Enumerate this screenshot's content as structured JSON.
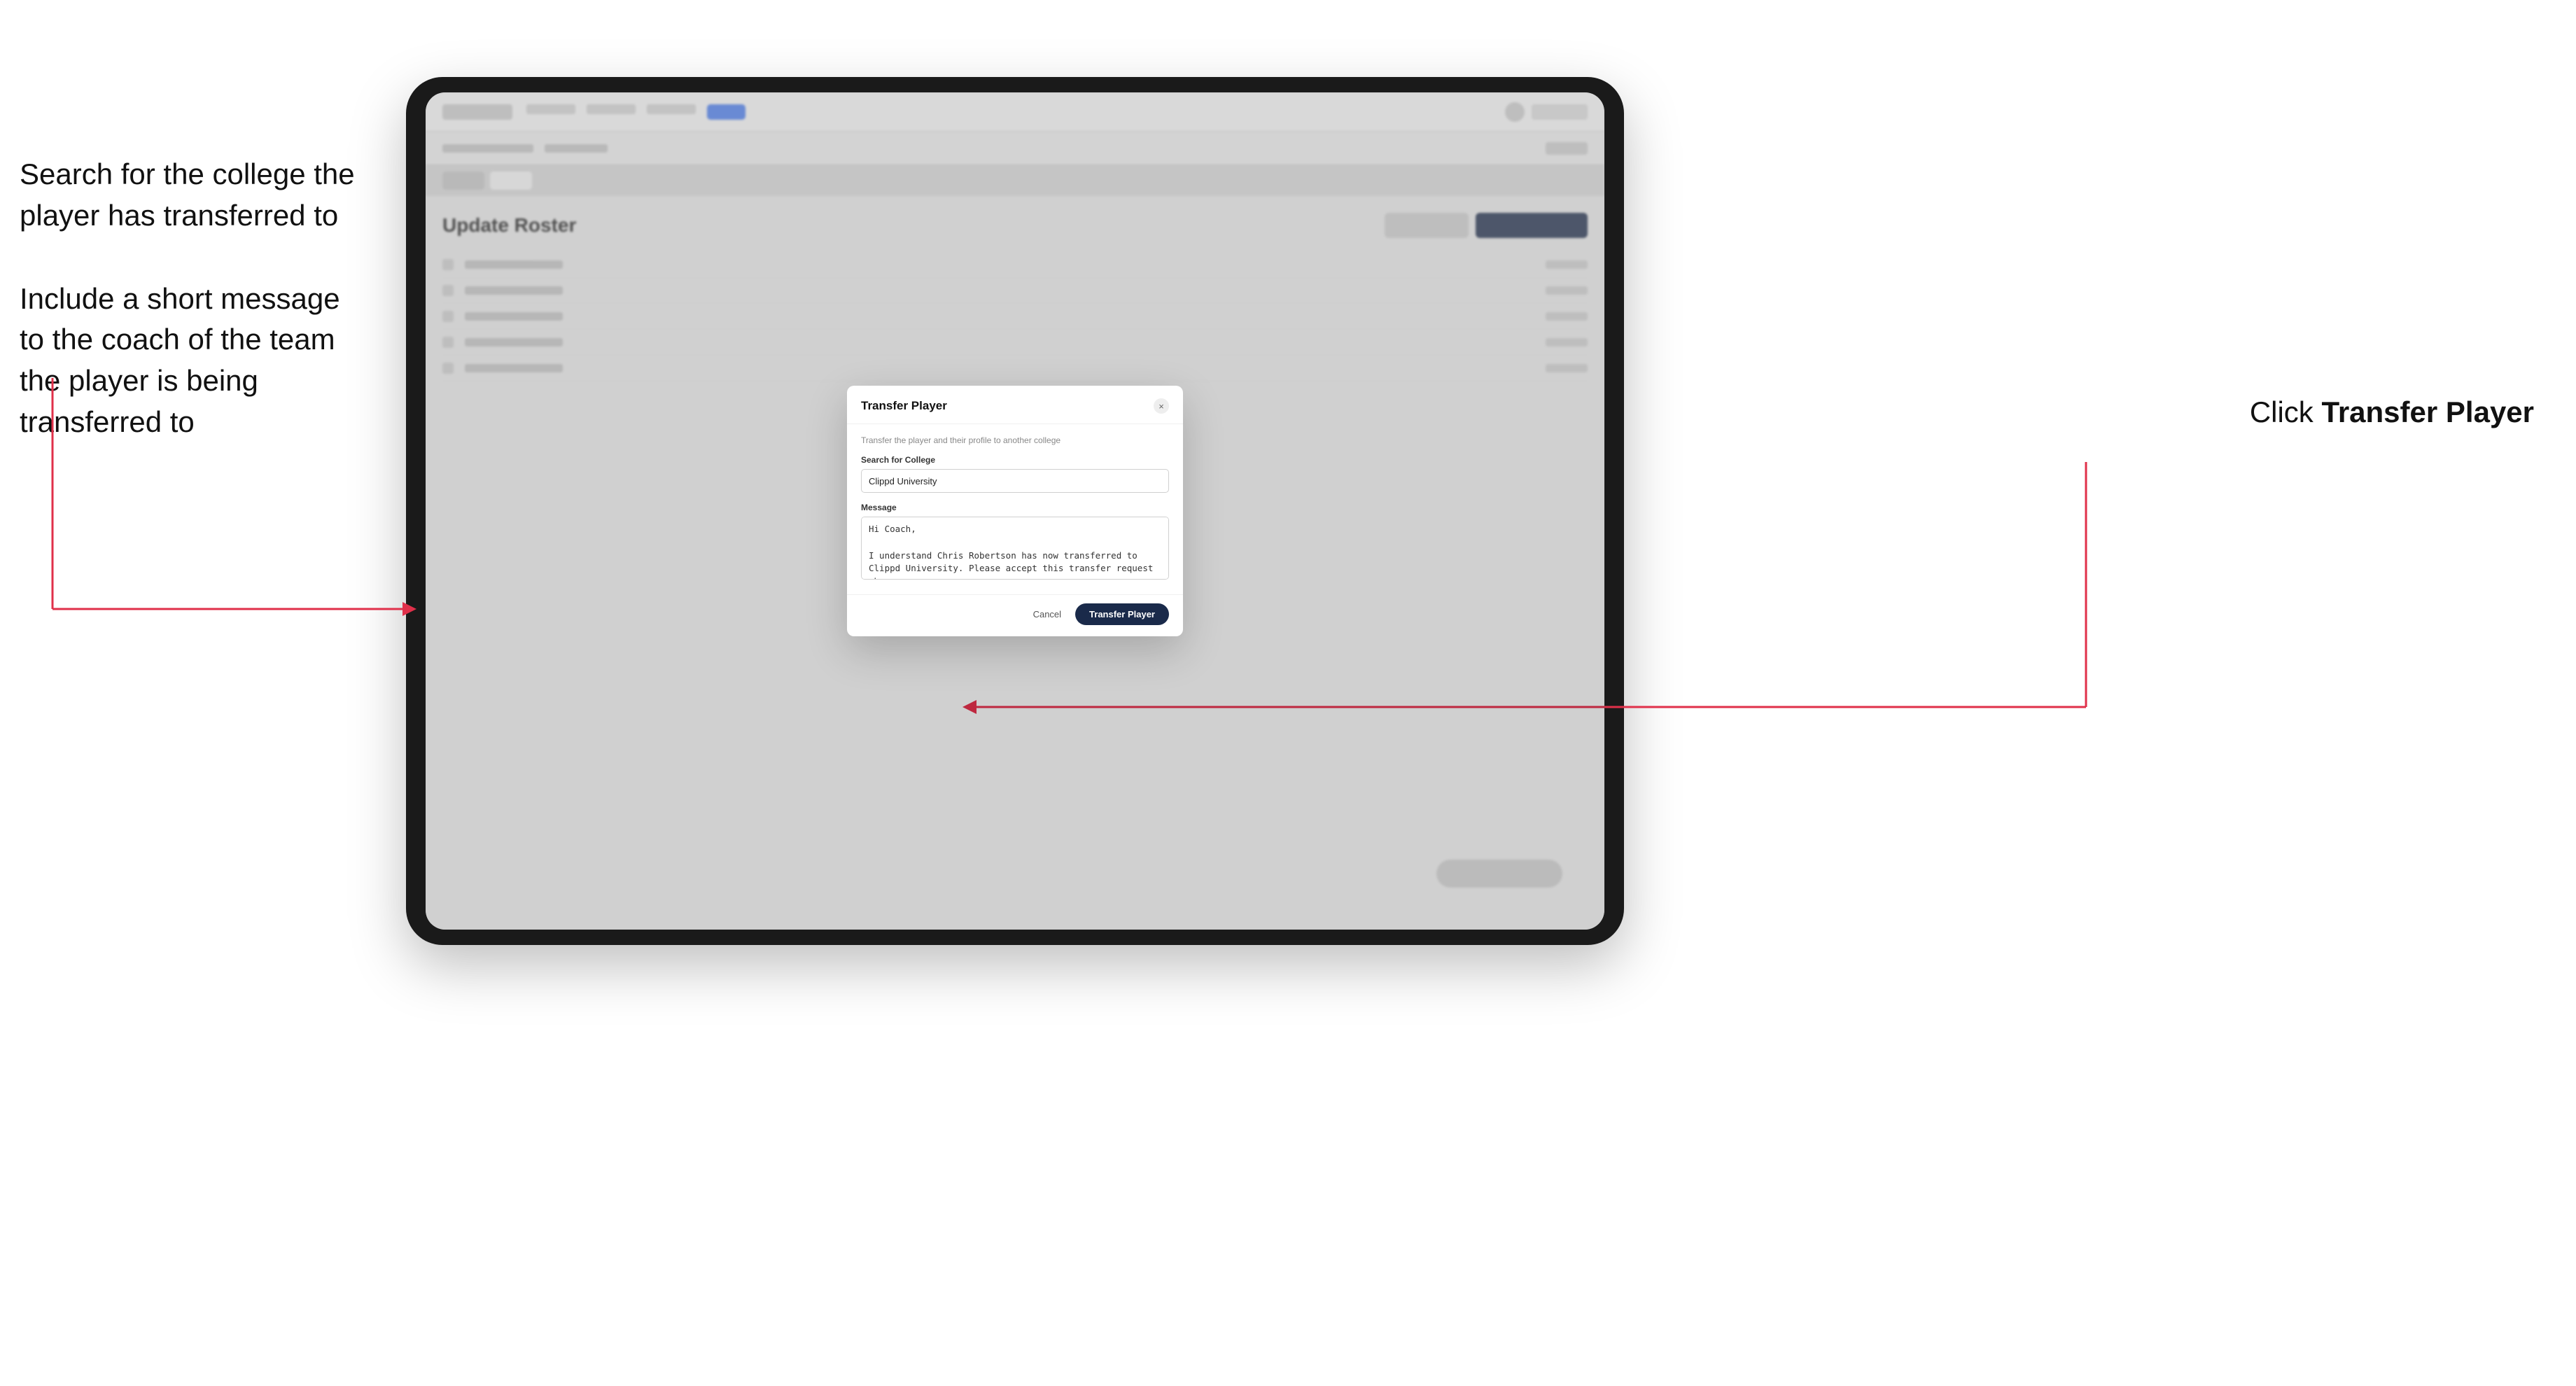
{
  "annotations": {
    "left_block1_line1": "Search for the college the",
    "left_block1_line2": "player has transferred to",
    "left_block2_line1": "Include a short message",
    "left_block2_line2": "to the coach of the team",
    "left_block2_line3": "the player is being",
    "left_block2_line4": "transferred to",
    "right_prefix": "Click ",
    "right_bold": "Transfer Player"
  },
  "dialog": {
    "title": "Transfer Player",
    "subtitle": "Transfer the player and their profile to another college",
    "search_label": "Search for College",
    "search_value": "Clippd University",
    "message_label": "Message",
    "message_value": "Hi Coach,\n\nI understand Chris Robertson has now transferred to Clippd University. Please accept this transfer request when you can.",
    "cancel_label": "Cancel",
    "transfer_label": "Transfer Player"
  },
  "page": {
    "title": "Update Roster"
  },
  "close_icon": "×"
}
